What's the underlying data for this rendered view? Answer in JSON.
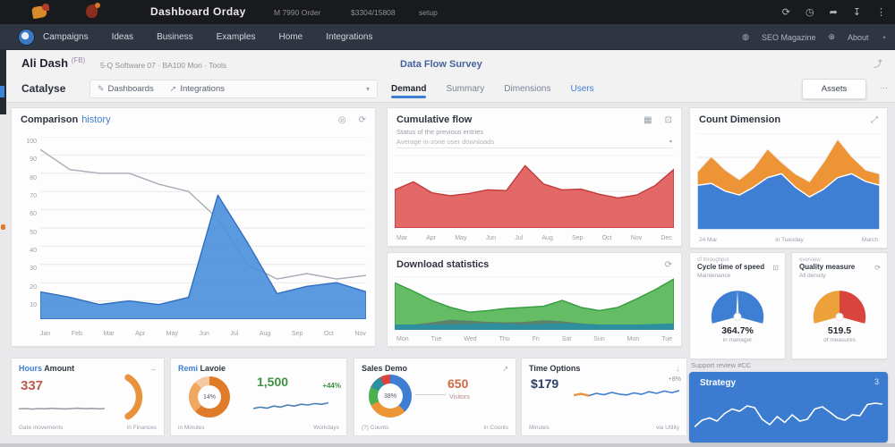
{
  "topbar": {
    "title": "Dashboard Orday",
    "meta1": "M 7990 Order",
    "meta2": "$3304/15808",
    "meta3": "setup"
  },
  "navbar": {
    "items": [
      "Campaigns",
      "Ideas",
      "Business",
      "Examples",
      "Home",
      "Integrations"
    ],
    "magazine": "SEO Magazine",
    "about": "About"
  },
  "header": {
    "page_title": "Ali Dash",
    "page_badge": "(FB)",
    "breadcrumb": "5-Q Software 07 · BA100 Mon · Tools",
    "center_title": "Data Flow Survey",
    "section_title": "Catalyse",
    "tabstrip": [
      {
        "label": "Dashboards"
      },
      {
        "label": "Integrations"
      }
    ],
    "center_tabs": [
      {
        "label": "Demand"
      },
      {
        "label": "Summary"
      },
      {
        "label": "Dimensions"
      },
      {
        "label": "Users"
      }
    ],
    "assets_button": "Assets"
  },
  "panels": {
    "comparison": {
      "title": "Comparison",
      "link": "history"
    },
    "cumulative": {
      "title": "Cumulative flow",
      "sub1": "Status of the previous entries",
      "sub2": "Average in-zone user downloads"
    },
    "downloads": {
      "title": "Download statistics"
    },
    "dimension": {
      "title": "Count Dimension"
    },
    "gauge1": {
      "overline": "of throughput",
      "title": "Cycle time of speed",
      "sub": "Maintenance",
      "footer": "in manager"
    },
    "gauge2": {
      "overline": "overview",
      "title": "Quality measure",
      "sub": "All density",
      "footer": "of measures"
    },
    "kpi1": {
      "title_a": "Hours",
      "title_b": "Amount",
      "value": "337",
      "foot_l": "Gate movements",
      "foot_r": "in Finances"
    },
    "kpi2": {
      "title_a": "Remi",
      "title_b": "Lavoie",
      "value": "1,500",
      "badge": "+44%",
      "foot_l": "in Minutes",
      "foot_r": "Workdays"
    },
    "kpi3": {
      "title": "Sales Demo",
      "value": "650",
      "sub": "Visitors",
      "foot_l": "(?) Counts",
      "foot_r": "in Counts"
    },
    "kpi4": {
      "title": "Time Options",
      "value": "$179",
      "badge": "+8%",
      "foot_l": "Minutes",
      "foot_r": "via Utility"
    },
    "strategy": {
      "label": "Support review #CC",
      "title": "Strategy",
      "corner": "3"
    }
  },
  "icons": {
    "refresh": "⟳",
    "clock": "◷",
    "share": "➦",
    "download": "↧",
    "more": "⋮",
    "help": "◍",
    "globe": "⊕",
    "user": "◔",
    "chevron": "▾",
    "edit": "✎",
    "link": "➚",
    "eye": "◎",
    "grid": "▦",
    "frame": "⊡",
    "expand": "⤢",
    "export": "↗",
    "arrow_right": "→",
    "arrow_down": "↓",
    "dots": "⋯",
    "share2": "⤴"
  },
  "colors": {
    "accent_blue": "#3e7fd4",
    "area_blue": "#4a8fdd",
    "area_red": "#e15b5b",
    "area_green": "#5cb85c",
    "area_orange": "#ec9436",
    "gauge_orange": "#eda13b",
    "gauge_red": "#d9453d",
    "card_blue": "#3b7cd1"
  },
  "chart_data": [
    {
      "id": "comparison",
      "type": "area",
      "title": "Comparison history",
      "ylim": [
        0,
        100
      ],
      "grid": 10,
      "legend": "none",
      "y_labels": [
        "100",
        "90",
        "80",
        "70",
        "60",
        "50",
        "40",
        "30",
        "20",
        "10"
      ],
      "x_labels": [
        "Jan",
        "Feb",
        "Mar",
        "Apr",
        "May",
        "Jun",
        "Jul",
        "Aug",
        "Sep",
        "Oct",
        "Nov"
      ],
      "series": [
        {
          "name": "previous period",
          "kind": "line",
          "color": "#a7adb5",
          "values": [
            93,
            82,
            80,
            80,
            74,
            70,
            55,
            30,
            22,
            25,
            22,
            24
          ]
        },
        {
          "name": "current period",
          "kind": "area",
          "color": "#4a8fdd",
          "stroke": "#2f6fbe",
          "fill_opacity": 0.9,
          "values": [
            15,
            12,
            8,
            10,
            8,
            12,
            68,
            42,
            14,
            18,
            20,
            15
          ]
        }
      ]
    },
    {
      "id": "cumulative",
      "type": "area",
      "title": "Cumulative flow",
      "ylim": [
        0,
        100
      ],
      "grid": 4,
      "x_labels": [
        "Mar",
        "Apr",
        "May",
        "Jun",
        "Jul",
        "Aug",
        "Sep",
        "Oct",
        "Nov",
        "Dec"
      ],
      "series": [
        {
          "name": "flow",
          "kind": "area",
          "color": "#e15b5b",
          "stroke": "#c23a3a",
          "fill_opacity": 0.92,
          "values": [
            52,
            63,
            48,
            44,
            47,
            52,
            51,
            85,
            60,
            52,
            53,
            46,
            41,
            45,
            58,
            80
          ]
        }
      ]
    },
    {
      "id": "downloads",
      "type": "area",
      "title": "Download statistics",
      "ylim": [
        0,
        100
      ],
      "grid": 3,
      "x_labels": [
        "Mon",
        "Tue",
        "Wed",
        "Thu",
        "Fri",
        "Sat",
        "Sun",
        "Mon",
        "Tue"
      ],
      "series": [
        {
          "name": "downloads",
          "kind": "area",
          "color": "#5cb85c",
          "stroke": "#379b3f",
          "fill_opacity": 0.95,
          "values": [
            88,
            72,
            55,
            42,
            33,
            36,
            40,
            42,
            44,
            55,
            42,
            36,
            42,
            58,
            75,
            95
          ]
        },
        {
          "name": "installs",
          "kind": "area",
          "color": "#5a6e6e",
          "fill_opacity": 0.75,
          "values": [
            8,
            10,
            14,
            19,
            17,
            15,
            14,
            15,
            18,
            16,
            12,
            10,
            9,
            8,
            8,
            8
          ]
        },
        {
          "name": "base",
          "kind": "area",
          "color": "#2e8fa0",
          "fill_opacity": 1,
          "values": [
            10,
            10,
            10,
            10,
            11,
            12,
            11,
            10,
            11,
            12,
            11,
            10,
            10,
            10,
            11,
            12
          ]
        }
      ]
    },
    {
      "id": "dimension",
      "type": "area",
      "title": "Count Dimension",
      "ylim": [
        0,
        100
      ],
      "grid": 4,
      "stacked": true,
      "x_labels": [
        "24 Mar",
        "in Tuesday",
        "March"
      ],
      "series": [
        {
          "name": "total",
          "kind": "area",
          "color": "#ec9436",
          "stroke": "#f3f3f3",
          "fill_opacity": 1,
          "values": [
            60,
            76,
            62,
            52,
            64,
            84,
            70,
            58,
            50,
            70,
            94,
            76,
            62,
            58
          ]
        },
        {
          "name": "primary",
          "kind": "area",
          "color": "#3e7fd4",
          "stroke": "#ffffff",
          "fill_opacity": 1,
          "values": [
            46,
            48,
            40,
            36,
            44,
            54,
            58,
            44,
            34,
            42,
            54,
            58,
            50,
            46
          ]
        }
      ]
    },
    {
      "id": "gauge-cycle",
      "type": "gauge",
      "value": "364.7%",
      "needle": true,
      "segments": [
        {
          "color": "#3e7fd4",
          "start": 195,
          "end": -15
        }
      ]
    },
    {
      "id": "gauge-quality",
      "type": "gauge",
      "value": "519.5",
      "needle": false,
      "segments": [
        {
          "color": "#eda13b",
          "start": 195,
          "end": 90
        },
        {
          "color": "#d9453d",
          "start": 90,
          "end": -15
        }
      ]
    },
    {
      "id": "spark-hours",
      "type": "sparkline",
      "color": "#9aa0a6",
      "values": [
        48,
        50,
        46,
        50,
        48,
        52,
        49,
        47,
        50,
        53,
        49,
        51,
        48,
        50
      ]
    },
    {
      "id": "arc-hours",
      "type": "arc",
      "color": "#e8923a"
    },
    {
      "id": "donut-layers",
      "type": "donut",
      "center": "14%",
      "segments": [
        {
          "color": "#e07b2a",
          "pct": 62
        },
        {
          "color": "#f0a75f",
          "pct": 26
        },
        {
          "color": "#f6caa0",
          "pct": 12
        }
      ]
    },
    {
      "id": "spark-layers",
      "type": "sparkline",
      "color": "#4a7fb5",
      "values": [
        30,
        38,
        32,
        44,
        38,
        50,
        44,
        54,
        50,
        58,
        54,
        62
      ]
    },
    {
      "id": "donut-sales",
      "type": "donut",
      "center": "38%",
      "segments": [
        {
          "color": "#3e7fd4",
          "pct": 38
        },
        {
          "color": "#ec9436",
          "pct": 30
        },
        {
          "color": "#4caf50",
          "pct": 14
        },
        {
          "color": "#2e8fa0",
          "pct": 10
        },
        {
          "color": "#d9453d",
          "pct": 8
        }
      ]
    },
    {
      "id": "spark-time",
      "type": "sparkline",
      "color": "#3e7fd4",
      "head_color": "#e8923a",
      "head_n": 3,
      "values": [
        42,
        48,
        40,
        50,
        44,
        54,
        47,
        43,
        52,
        46,
        57,
        50,
        60,
        53,
        62
      ]
    },
    {
      "id": "strategy",
      "type": "line",
      "color": "#ffffff",
      "values": [
        25,
        40,
        45,
        38,
        55,
        65,
        60,
        72,
        68,
        42,
        30,
        48,
        35,
        52,
        38,
        42,
        65,
        70,
        58,
        45,
        40,
        52,
        50,
        75,
        78,
        76
      ]
    }
  ]
}
